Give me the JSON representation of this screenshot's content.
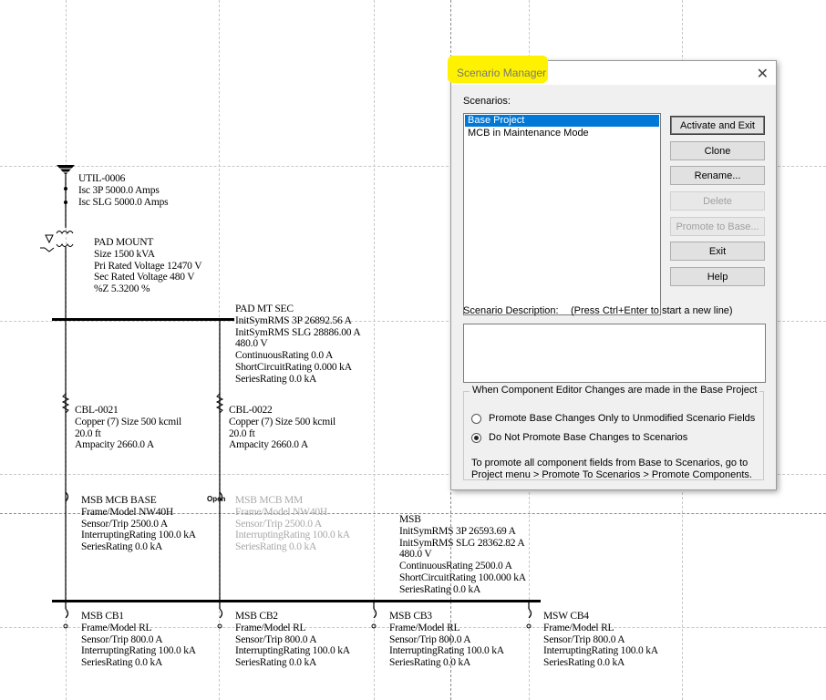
{
  "diagram": {
    "utility": {
      "name": "UTIL-0006",
      "lines": [
        "Isc 3P 5000.0 Amps",
        "Isc SLG 5000.0 Amps"
      ]
    },
    "transformer": {
      "lines": [
        "PAD MOUNT",
        "Size 1500 kVA",
        "Pri Rated Voltage 12470 V",
        "Sec Rated Voltage 480  V",
        "%Z 5.3200 %"
      ]
    },
    "pad_mt_sec": {
      "lines": [
        "PAD MT SEC",
        "InitSymRMS 3P 26892.56 A",
        "InitSymRMS SLG 28886.00 A",
        "480.0 V",
        "ContinuousRating 0.0 A",
        "ShortCircuitRating 0.000 kA",
        "SeriesRating 0.0 kA"
      ]
    },
    "cable1": {
      "lines": [
        "CBL-0021",
        "Copper (7) Size 500 kcmil",
        "20.0 ft",
        "Ampacity 2660.0 A"
      ]
    },
    "cable2": {
      "lines": [
        "CBL-0022",
        "Copper (7) Size 500 kcmil",
        "20.0 ft",
        "Ampacity 2660.0 A"
      ]
    },
    "mcb_base": {
      "lines": [
        "MSB MCB BASE",
        "Frame/Model NW40H",
        "Sensor/Trip 2500.0 A",
        "InterruptingRating 100.0 kA",
        "SeriesRating 0.0 kA"
      ]
    },
    "mcb_mm": {
      "open_label": "Open",
      "lines": [
        "MSB MCB MM",
        "Frame/Model NW40H",
        "Sensor/Trip 2500.0 A",
        "InterruptingRating 100.0 kA",
        "SeriesRating 0.0 kA"
      ]
    },
    "msb": {
      "lines": [
        "MSB",
        "InitSymRMS 3P 26593.69 A",
        "InitSymRMS SLG 28362.82 A",
        "480.0 V",
        "ContinuousRating 2500.0 A",
        "ShortCircuitRating 100.000 kA",
        "SeriesRating 0.0 kA"
      ]
    },
    "cb1": {
      "lines": [
        "MSB CB1",
        "Frame/Model RL",
        "Sensor/Trip 800.0 A",
        "InterruptingRating 100.0 kA",
        "SeriesRating 0.0 kA"
      ]
    },
    "cb2": {
      "lines": [
        "MSB CB2",
        "Frame/Model RL",
        "Sensor/Trip 800.0 A",
        "InterruptingRating 100.0 kA",
        "SeriesRating 0.0 kA"
      ]
    },
    "cb3": {
      "lines": [
        "MSB CB3",
        "Frame/Model RL",
        "Sensor/Trip 800.0 A",
        "InterruptingRating 100.0 kA",
        "SeriesRating 0.0 kA"
      ]
    },
    "cb4": {
      "lines": [
        "MSW CB4",
        "Frame/Model RL",
        "Sensor/Trip 800.0 A",
        "InterruptingRating 100.0 kA",
        "SeriesRating 0.0 kA"
      ]
    }
  },
  "dialog": {
    "title": "Scenario Manager",
    "close_glyph": "✕",
    "highlight_color": "#fff200",
    "scenarios_label": "Scenarios:",
    "scenarios": [
      {
        "label": "Base Project",
        "selected": true
      },
      {
        "label": "MCB in Maintenance Mode",
        "selected": false
      }
    ],
    "buttons": {
      "activate": "Activate and Exit",
      "clone": "Clone",
      "rename": "Rename...",
      "delete": "Delete",
      "promote": "Promote to Base...",
      "exit": "Exit",
      "help": "Help"
    },
    "description_label": "Scenario Description:",
    "description_hint": "(Press Ctrl+Enter to start a new line)",
    "description_value": "",
    "group_title": "When Component Editor Changes are made in the Base Project",
    "radio_promote": "Promote Base Changes Only to Unmodified Scenario Fields",
    "radio_no_promote": "Do Not Promote Base Changes to Scenarios",
    "radio_selected": "no_promote",
    "note": "To promote all component fields from Base to Scenarios, go to Project menu > Promote To Scenarios > Promote Components.",
    "selection_color": "#0078d7"
  }
}
